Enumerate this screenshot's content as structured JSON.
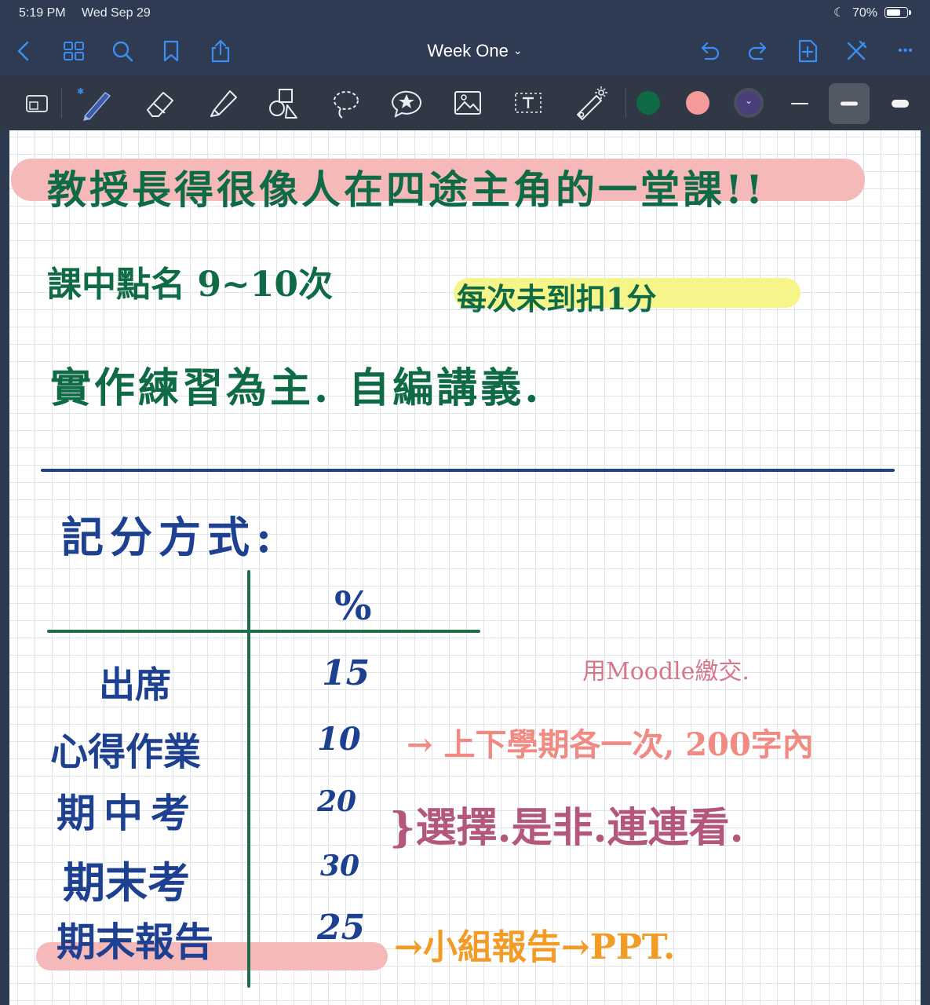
{
  "status_bar": {
    "time": "5:19 PM",
    "date": "Wed Sep 29",
    "battery": "70%",
    "battery_level": 0.7
  },
  "nav": {
    "title": "Week One",
    "title_chevron": "⌄",
    "more": "•••"
  },
  "toolbar": {
    "tools": [
      "zoom-window",
      "pen",
      "eraser",
      "highlighter",
      "shapes",
      "lasso",
      "elements",
      "image",
      "text",
      "laser-pointer"
    ],
    "colors": [
      "#0f6b45",
      "#f39a9a",
      "#4a3f7a"
    ],
    "selected_color": "#4a3f7a",
    "stroke_sizes": [
      "thin",
      "medium",
      "thick"
    ],
    "selected_stroke": "medium"
  },
  "note": {
    "header_line": "教授長得很像人在四途主角的一堂課!!",
    "line2_left": "課中點名 9~10次",
    "line2_right": "每次未到扣1分",
    "line3": "實作練習為主. 自編講義.",
    "grading_title": "記分方式:",
    "table": {
      "percent_header": "%",
      "rows": [
        {
          "label": "出席",
          "value": "15"
        },
        {
          "label": "心得作業",
          "value": "10"
        },
        {
          "label": "期中考",
          "value": "20"
        },
        {
          "label": "期末考",
          "value": "30"
        },
        {
          "label": "期末報告",
          "value": "25"
        }
      ]
    },
    "annotations": {
      "moodle": "用Moodle繳交.",
      "homework": "→ 上下學期各一次, 200字內",
      "exams": "}選擇.是非.連連看.",
      "report": "→小組報告→PPT."
    }
  }
}
